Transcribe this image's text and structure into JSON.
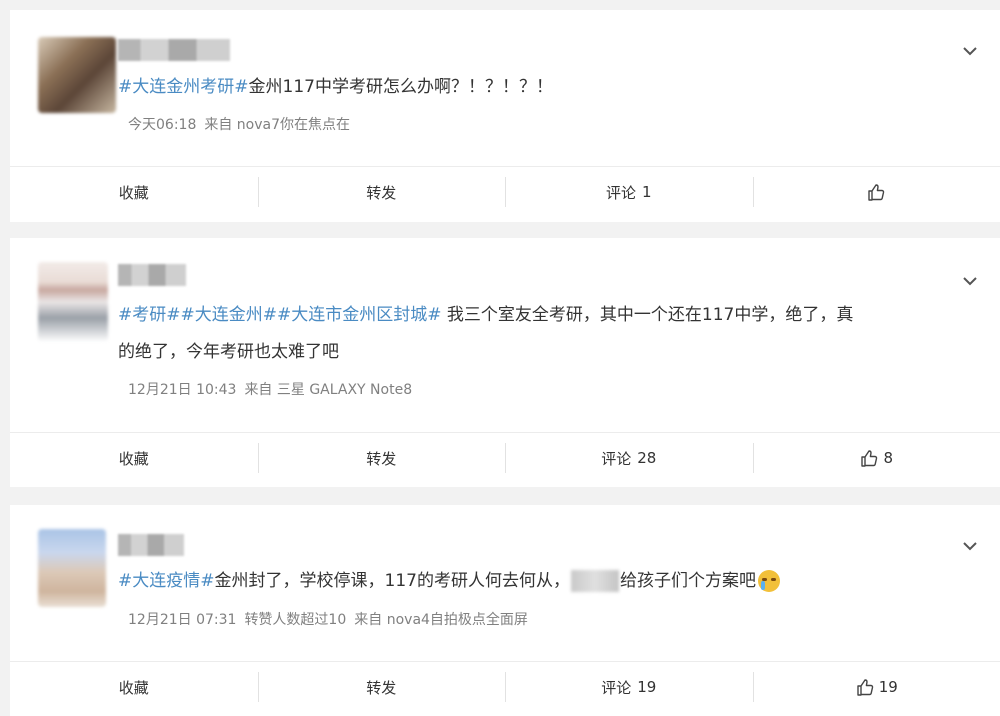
{
  "posts": [
    {
      "tags": [
        "#大连金州考研#"
      ],
      "text": "金州117中学考研怎么办啊？！？！？！",
      "meta": {
        "time": "今天06:18",
        "source": "来自 nova7你在焦点在"
      },
      "actions": {
        "collect": "收藏",
        "repost": "转发",
        "comment_label": "评论",
        "comment_count": "1",
        "like_count": ""
      }
    },
    {
      "tags": [
        "#考研#",
        "#大连金州#",
        "#大连市金州区封城#"
      ],
      "text_line1": " 我三个室友全考研，其中一个还在117中学，绝了，真",
      "text_line2": "的绝了，今年考研也太难了吧",
      "meta": {
        "time": "12月21日 10:43",
        "source": "来自 三星 GALAXY Note8"
      },
      "actions": {
        "collect": "收藏",
        "repost": "转发",
        "comment_label": "评论",
        "comment_count": "28",
        "like_count": "8"
      }
    },
    {
      "tags": [
        "#大连疫情#"
      ],
      "text_a": "金州封了，学校停课，117的考研人何去何从，",
      "text_b": "给孩子们个方案吧",
      "meta": {
        "time": "12月21日 07:31",
        "extra": "转赞人数超过10",
        "source": "来自 nova4自拍极点全面屏"
      },
      "actions": {
        "collect": "收藏",
        "repost": "转发",
        "comment_label": "评论",
        "comment_count": "19",
        "like_count": "19"
      }
    }
  ],
  "colors": {
    "tag": "#4a8bc3",
    "meta": "#808080",
    "background": "#f2f2f2"
  },
  "icons": {
    "expand": "chevron-down-icon",
    "like": "thumbs-up-icon",
    "emoji": "crying-emoji-icon"
  }
}
